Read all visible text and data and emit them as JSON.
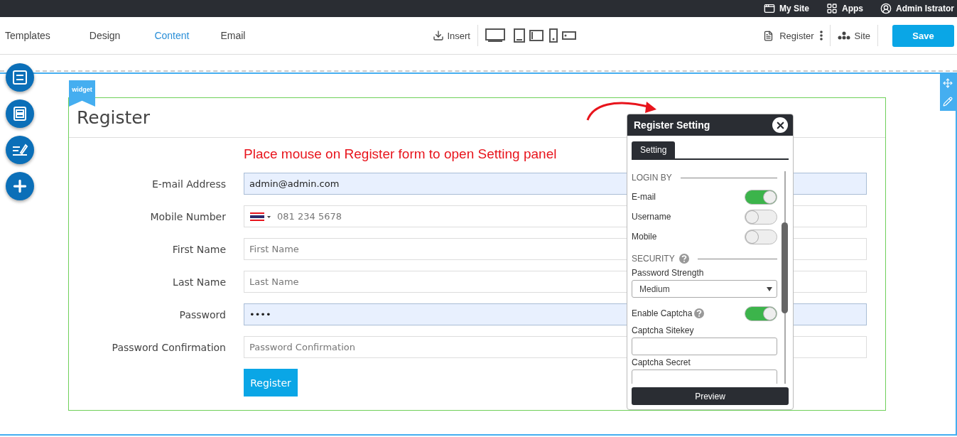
{
  "top_bar": {
    "items": [
      {
        "kind": "site",
        "label": "My Site"
      },
      {
        "kind": "apps",
        "label": "Apps"
      },
      {
        "kind": "user",
        "label": "Admin Istrator"
      }
    ]
  },
  "toolbar": {
    "tabs": [
      {
        "label": "Templates",
        "selected": false
      },
      {
        "label": "Design",
        "selected": false
      },
      {
        "label": "Content",
        "selected": true
      },
      {
        "label": "Email",
        "selected": false
      }
    ],
    "insert": "Insert",
    "page": "Register",
    "site": "Site",
    "save": "Save"
  },
  "widget": {
    "badge": "widget",
    "title": "Register",
    "hint": "Place mouse on Register form to open Setting panel",
    "fields": [
      {
        "kind": "text",
        "label": "E-mail Address",
        "value": "admin@admin.com",
        "autofilled": true
      },
      {
        "kind": "phone",
        "label": "Mobile Number",
        "placeholder": "081 234 5678",
        "autofilled": false
      },
      {
        "kind": "text",
        "label": "First Name",
        "placeholder": "First Name",
        "autofilled": false
      },
      {
        "kind": "text",
        "label": "Last Name",
        "placeholder": "Last Name",
        "autofilled": false
      },
      {
        "kind": "text",
        "label": "Password",
        "value": "••••",
        "autofilled": true
      },
      {
        "kind": "text",
        "label": "Password Confirmation",
        "placeholder": "Password Confirmation",
        "autofilled": false
      }
    ],
    "submit": "Register"
  },
  "settings_panel": {
    "title": "Register Setting",
    "tabs": [
      {
        "label": "Setting",
        "selected": true
      }
    ],
    "items": [
      {
        "kind": "section",
        "label": "LOGIN BY",
        "help": false
      },
      {
        "kind": "toggle",
        "label": "E-mail",
        "on": true,
        "help": false
      },
      {
        "kind": "toggle",
        "label": "Username",
        "on": false,
        "help": false
      },
      {
        "kind": "toggle",
        "label": "Mobile",
        "on": false,
        "help": false
      },
      {
        "kind": "section",
        "label": "SECURITY",
        "help": true
      },
      {
        "kind": "select",
        "label": "Password Strength",
        "value": "Medium"
      },
      {
        "kind": "toggle",
        "label": "Enable Captcha",
        "on": true,
        "help": true
      },
      {
        "kind": "input",
        "label": "Captcha Sitekey"
      },
      {
        "kind": "input",
        "label": "Captcha Secret"
      }
    ],
    "preview": "Preview"
  }
}
